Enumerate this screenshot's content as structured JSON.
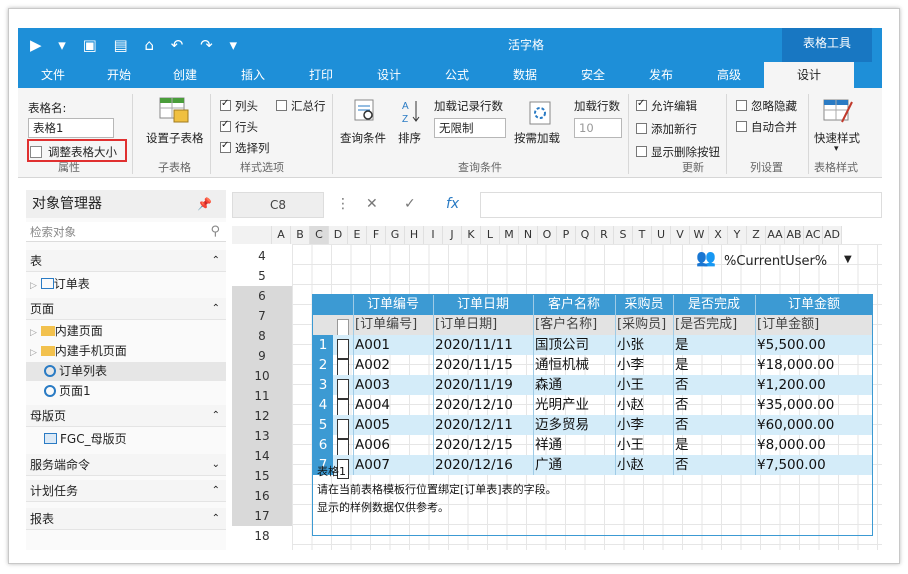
{
  "app": {
    "title": "活字格",
    "tool_tab": "表格工具"
  },
  "tabs": [
    "文件",
    "开始",
    "创建",
    "插入",
    "打印",
    "设计",
    "公式",
    "数据",
    "安全",
    "发布",
    "高级",
    "设计"
  ],
  "ribbon": {
    "table_name_label": "表格名:",
    "table_name_value": "表格1",
    "resize_button": "调整表格大小",
    "group_property": "属性",
    "subtable_button": "设置子表格",
    "group_subtable": "子表格",
    "style_options": {
      "col_header": "列头",
      "row_header": "行头",
      "select_col": "选择列",
      "total_row": "汇总行"
    },
    "group_style_options": "样式选项",
    "query_condition": "查询条件",
    "sort": "排序",
    "load_record_label": "加载记录行数",
    "load_record_value": "无限制",
    "on_demand_load": "按需加载",
    "load_rows_label": "加载行数",
    "load_rows_placeholder": "10",
    "group_query": "查询条件",
    "allow_edit": "允许编辑",
    "add_new_row": "添加新行",
    "show_delete_button": "显示删除按钮",
    "group_update": "更新",
    "ignore_hidden": "忽略隐藏",
    "auto_merge": "自动合并",
    "group_columns": "列设置",
    "quick_style": "快速样式",
    "group_table_style": "表格样式"
  },
  "sidebar": {
    "title": "对象管理器",
    "search_placeholder": "检索对象",
    "sections": {
      "table": "表",
      "table_item": "订单表",
      "page": "页面",
      "page_items": [
        "内建页面",
        "内建手机页面",
        "订单列表",
        "页面1"
      ],
      "master": "母版页",
      "master_item": "FGC_母版页",
      "server_cmd": "服务端命令",
      "schedule": "计划任务",
      "report": "报表"
    }
  },
  "formula": {
    "cell_ref": "C8",
    "fx": "fx"
  },
  "sheet": {
    "columns": [
      "A",
      "B",
      "C",
      "D",
      "E",
      "F",
      "G",
      "H",
      "I",
      "J",
      "K",
      "L",
      "M",
      "N",
      "O",
      "P",
      "Q",
      "R",
      "S",
      "T",
      "U",
      "V",
      "W",
      "X",
      "Y",
      "Z",
      "AA",
      "AB",
      "AC",
      "AD"
    ],
    "rows": [
      "4",
      "5",
      "6",
      "7",
      "8",
      "9",
      "10",
      "11",
      "12",
      "13",
      "14",
      "15",
      "16",
      "17",
      "18"
    ],
    "current_user": "%CurrentUser%",
    "table": {
      "headers": [
        "订单编号",
        "订单日期",
        "客户名称",
        "采购员",
        "是否完成",
        "订单金额"
      ],
      "template": [
        "[订单编号]",
        "[订单日期]",
        "[客户名称]",
        "[采购员]",
        "[是否完成]",
        "[订单金额]"
      ],
      "rows": [
        [
          "1",
          "A001",
          "2020/11/11",
          "国顶公司",
          "小张",
          "是",
          "¥5,500.00"
        ],
        [
          "2",
          "A002",
          "2020/11/15",
          "通恒机械",
          "小李",
          "是",
          "¥18,000.00"
        ],
        [
          "3",
          "A003",
          "2020/11/19",
          "森通",
          "小王",
          "否",
          "¥1,200.00"
        ],
        [
          "4",
          "A004",
          "2020/12/10",
          "光明产业",
          "小赵",
          "否",
          "¥35,000.00"
        ],
        [
          "5",
          "A005",
          "2020/12/11",
          "迈多贸易",
          "小李",
          "否",
          "¥60,000.00"
        ],
        [
          "6",
          "A006",
          "2020/12/15",
          "祥通",
          "小王",
          "是",
          "¥8,000.00"
        ],
        [
          "7",
          "A007",
          "2020/12/16",
          "广通",
          "小赵",
          "否",
          "¥7,500.00"
        ]
      ],
      "footer": [
        "表格1",
        "请在当前表格模板行位置绑定[订单表]表的字段。",
        "显示的样例数据仅供参考。"
      ]
    }
  },
  "colors": {
    "accent": "#1e8fd8",
    "table_header": "#3c9ad3",
    "alt_row": "#d4ecf9",
    "highlight": "#e03030"
  }
}
